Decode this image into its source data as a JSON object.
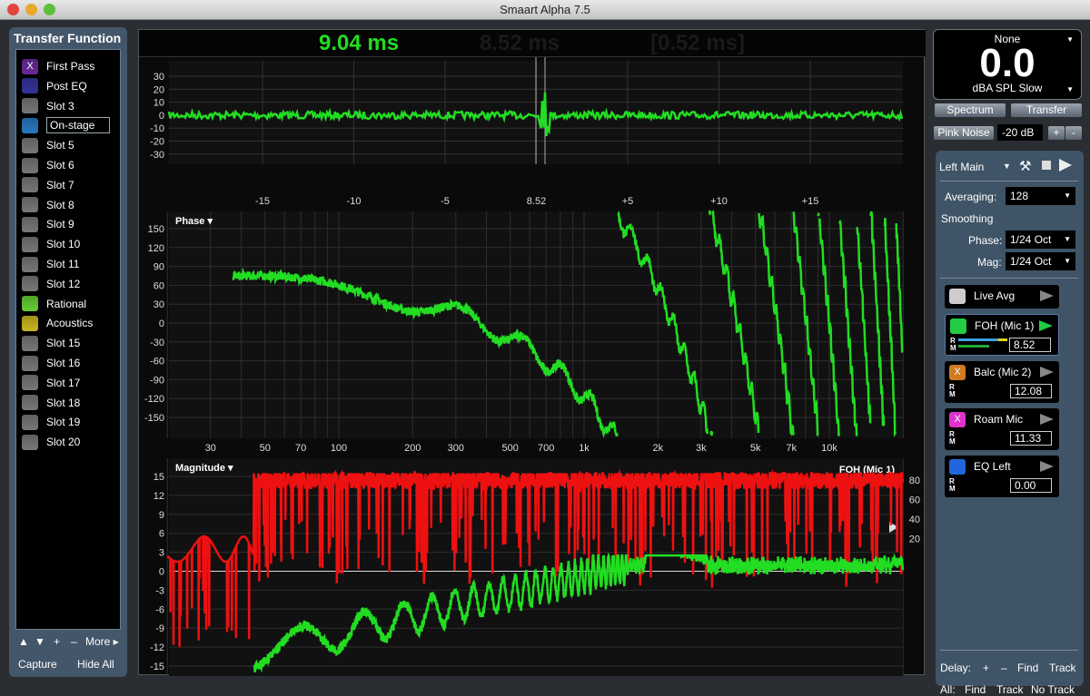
{
  "window": {
    "title": "Smaart Alpha 7.5"
  },
  "left": {
    "title": "Transfer Function",
    "slots": [
      {
        "label": "First Pass",
        "color": "#6a2a9a",
        "mark": "X"
      },
      {
        "label": "Post EQ",
        "color": "#33339a",
        "mark": ""
      },
      {
        "label": "Slot 3",
        "color": "#777777",
        "mark": ""
      },
      {
        "label": "On-stage",
        "color": "#2a78c0",
        "mark": "",
        "selected": true
      },
      {
        "label": "Slot 5",
        "color": "#777777",
        "mark": ""
      },
      {
        "label": "Slot 6",
        "color": "#777777",
        "mark": ""
      },
      {
        "label": "Slot 7",
        "color": "#777777",
        "mark": ""
      },
      {
        "label": "Slot 8",
        "color": "#777777",
        "mark": ""
      },
      {
        "label": "Slot 9",
        "color": "#777777",
        "mark": ""
      },
      {
        "label": "Slot 10",
        "color": "#777777",
        "mark": ""
      },
      {
        "label": "Slot 11",
        "color": "#777777",
        "mark": ""
      },
      {
        "label": "Slot 12",
        "color": "#777777",
        "mark": ""
      },
      {
        "label": "Rational",
        "color": "#66cc33",
        "mark": ""
      },
      {
        "label": "Acoustics",
        "color": "#c8b420",
        "mark": ""
      },
      {
        "label": "Slot 15",
        "color": "#777777",
        "mark": ""
      },
      {
        "label": "Slot 16",
        "color": "#777777",
        "mark": ""
      },
      {
        "label": "Slot 17",
        "color": "#777777",
        "mark": ""
      },
      {
        "label": "Slot 18",
        "color": "#777777",
        "mark": ""
      },
      {
        "label": "Slot 19",
        "color": "#777777",
        "mark": ""
      },
      {
        "label": "Slot 20",
        "color": "#777777",
        "mark": ""
      }
    ],
    "footer": {
      "up": "▲",
      "down": "▼",
      "plus": "+",
      "minus": "–",
      "more": "More ▸",
      "capture": "Capture",
      "hide_all": "Hide All"
    }
  },
  "header": {
    "delay": "9.04 ms",
    "delay2": "8.52 ms",
    "delay_diff": "[0.52 ms]"
  },
  "impulse": {
    "y_ticks": [
      "30",
      "20",
      "10",
      "0",
      "-10",
      "-20",
      "-30"
    ],
    "x_ticks": [
      "-15",
      "-10",
      "-5",
      "8.52",
      "+5",
      "+10",
      "+15"
    ]
  },
  "phase": {
    "label": "Phase ▾",
    "y_ticks": [
      "150",
      "120",
      "90",
      "60",
      "30",
      "0",
      "-30",
      "-60",
      "-90",
      "-120",
      "-150"
    ]
  },
  "magnitude": {
    "label": "Magnitude ▾",
    "trace_label": "FOH (Mic 1)",
    "y_ticks": [
      "15",
      "12",
      "9",
      "6",
      "3",
      "0",
      "-3",
      "-6",
      "-9",
      "-12",
      "-15"
    ],
    "right_ticks": [
      "80",
      "60",
      "40",
      "20"
    ]
  },
  "freq_ticks": [
    "30",
    "50",
    "70",
    "100",
    "200",
    "300",
    "500",
    "700",
    "1k",
    "2k",
    "3k",
    "5k",
    "7k",
    "10k"
  ],
  "colors": {
    "trace": "#22dd22",
    "magnitude_trace": "#ee1111"
  },
  "meter": {
    "source": "None",
    "value": "0.0",
    "unit": "dBA SPL Slow"
  },
  "buttons": {
    "spectrum": "Spectrum",
    "transfer": "Transfer",
    "pink_noise": "Pink Noise",
    "level": "-20 dB",
    "plus": "+",
    "minus": "-"
  },
  "config": {
    "name": "Left Main",
    "averaging_label": "Averaging:",
    "averaging": "128",
    "smoothing": "Smoothing",
    "phase_label": "Phase:",
    "phase": "1/24 Oct",
    "mag_label": "Mag:",
    "mag": "1/24 Oct"
  },
  "tracks": [
    {
      "name": "Live Avg",
      "color": "#cccccc",
      "mark": "",
      "delay": null
    },
    {
      "name": "FOH (Mic 1)",
      "color": "#22cc44",
      "mark": "",
      "delay": "8.52",
      "active": true
    },
    {
      "name": "Balc (Mic 2)",
      "color": "#d07a20",
      "mark": "X",
      "delay": "12.08"
    },
    {
      "name": "Roam Mic",
      "color": "#dd33cc",
      "mark": "X",
      "delay": "11.33"
    },
    {
      "name": "EQ Left",
      "color": "#2266dd",
      "mark": "",
      "delay": "0.00"
    }
  ],
  "footer": {
    "delay_label": "Delay:",
    "plus": "+",
    "minus": "–",
    "find": "Find",
    "track": "Track",
    "all_label": "All:",
    "all_find": "Find",
    "all_track": "Track",
    "no_track": "No Track"
  }
}
